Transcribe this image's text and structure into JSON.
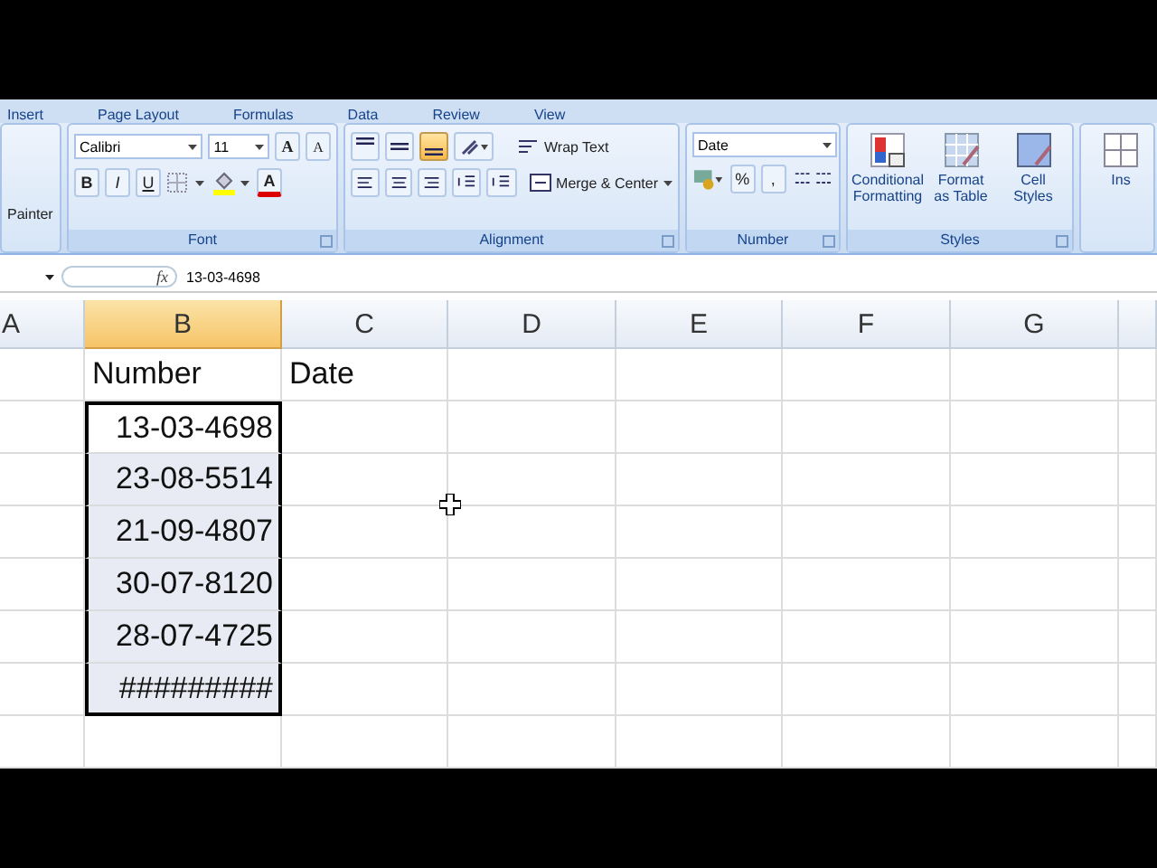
{
  "ribbon_tabs": [
    "Insert",
    "Page Layout",
    "Formulas",
    "Data",
    "Review",
    "View"
  ],
  "clipboard": {
    "format_painter": "Painter"
  },
  "font": {
    "font_name": "Calibri",
    "font_size": "11",
    "grow": "A",
    "shrink": "A",
    "bold": "B",
    "italic": "I",
    "underline": "U",
    "font_color": "A",
    "label": "Font"
  },
  "alignment": {
    "vertical": [
      {
        "kind": "top",
        "selected": false
      },
      {
        "kind": "middle",
        "selected": false
      },
      {
        "kind": "bottom",
        "selected": true
      }
    ],
    "wrap_text": "Wrap Text",
    "merge": "Merge & Center",
    "label": "Alignment"
  },
  "number": {
    "format": "Date",
    "percent": "%",
    "comma": ",",
    "label": "Number"
  },
  "styles": {
    "buttons": [
      {
        "line1": "Conditional",
        "line2": "Formatting",
        "kind": "conditional"
      },
      {
        "line1": "Format",
        "line2": "as Table",
        "kind": "table"
      },
      {
        "line1": "Cell",
        "line2": "Styles",
        "kind": "cell"
      }
    ],
    "label": "Styles"
  },
  "cells": {
    "insert": "Ins"
  },
  "formula_bar": {
    "fx": "fx",
    "value": "13-03-4698"
  },
  "sheet": {
    "columns": [
      {
        "label": "A",
        "selected": false
      },
      {
        "label": "B",
        "selected": true
      },
      {
        "label": "C",
        "selected": false
      },
      {
        "label": "D",
        "selected": false
      },
      {
        "label": "E",
        "selected": false
      },
      {
        "label": "F",
        "selected": false
      },
      {
        "label": "G",
        "selected": false
      }
    ],
    "rows": [
      {
        "b": "Number",
        "c": "Date",
        "selected": false
      },
      {
        "b": "13-03-4698",
        "selected": true,
        "active": true
      },
      {
        "b": "23-08-5514",
        "selected": true,
        "active": false
      },
      {
        "b": "21-09-4807",
        "selected": true,
        "active": false
      },
      {
        "b": "30-07-8120",
        "selected": true,
        "active": false
      },
      {
        "b": "28-07-4725",
        "selected": true,
        "active": false
      },
      {
        "b": "#########",
        "selected": true,
        "active": false
      },
      {
        "selected": false
      }
    ]
  }
}
